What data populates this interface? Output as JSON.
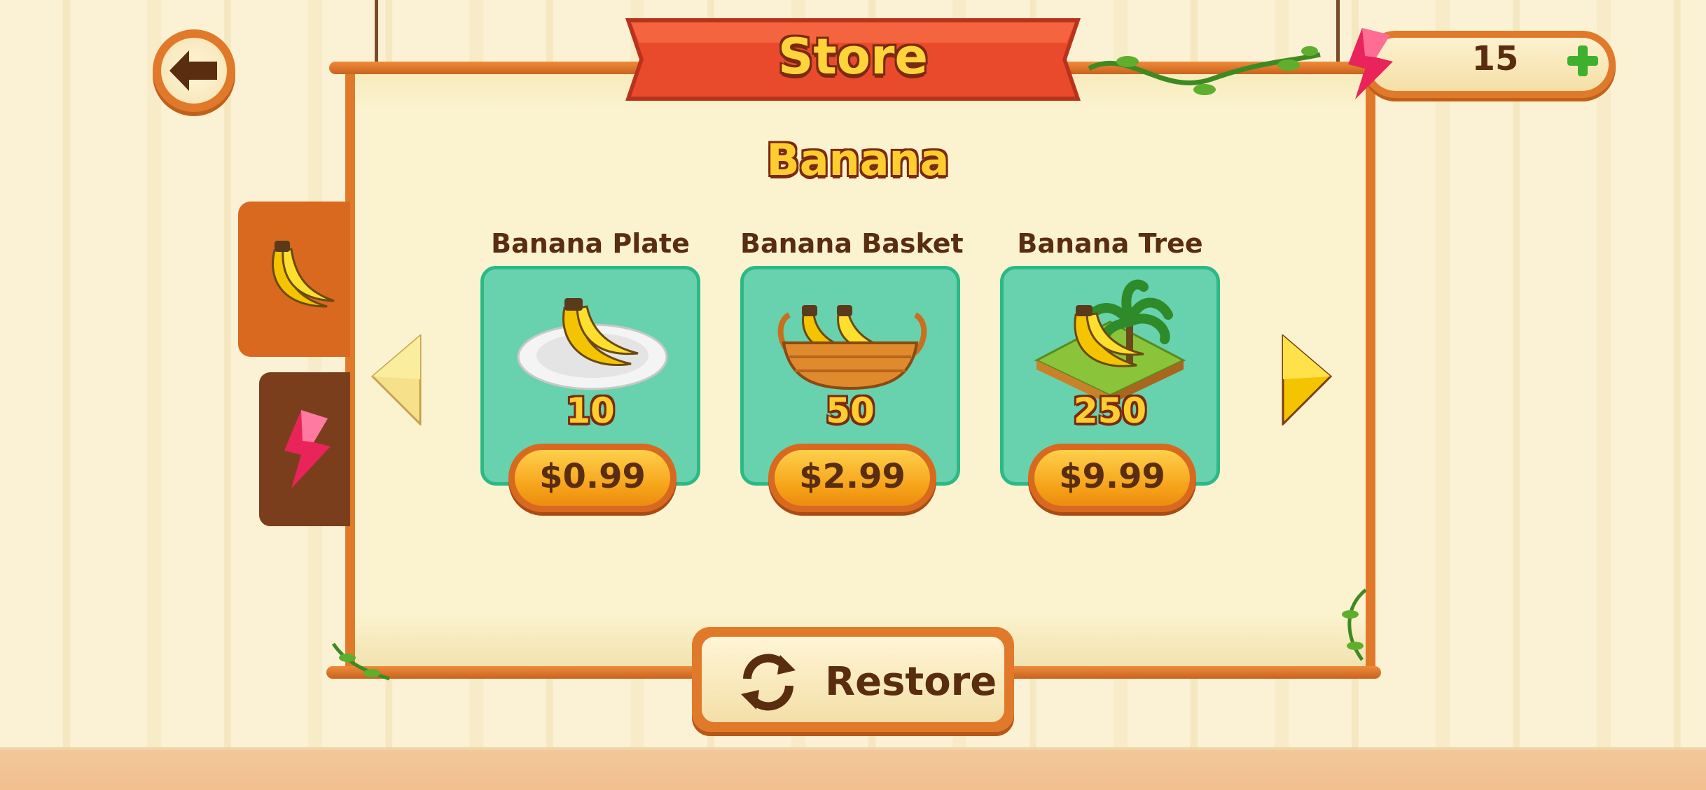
{
  "store": {
    "title": "Store",
    "section_title": "Banana",
    "currency_amount": "15",
    "tabs": [
      {
        "icon": "banana-icon",
        "active": true
      },
      {
        "icon": "lightning-gem-icon",
        "active": false
      }
    ],
    "items": [
      {
        "name": "Banana Plate",
        "amount": "10",
        "price": "$0.99",
        "icon": "banana-plate-icon"
      },
      {
        "name": "Banana Basket",
        "amount": "50",
        "price": "$2.99",
        "icon": "banana-basket-icon"
      },
      {
        "name": "Banana Tree",
        "amount": "250",
        "price": "$9.99",
        "icon": "banana-tree-icon"
      }
    ],
    "restore_label": "Restore"
  },
  "colors": {
    "frame": "#e07a2a",
    "card": "#67d2ad",
    "banner": "#e8432a",
    "text": "#5a2d10"
  }
}
